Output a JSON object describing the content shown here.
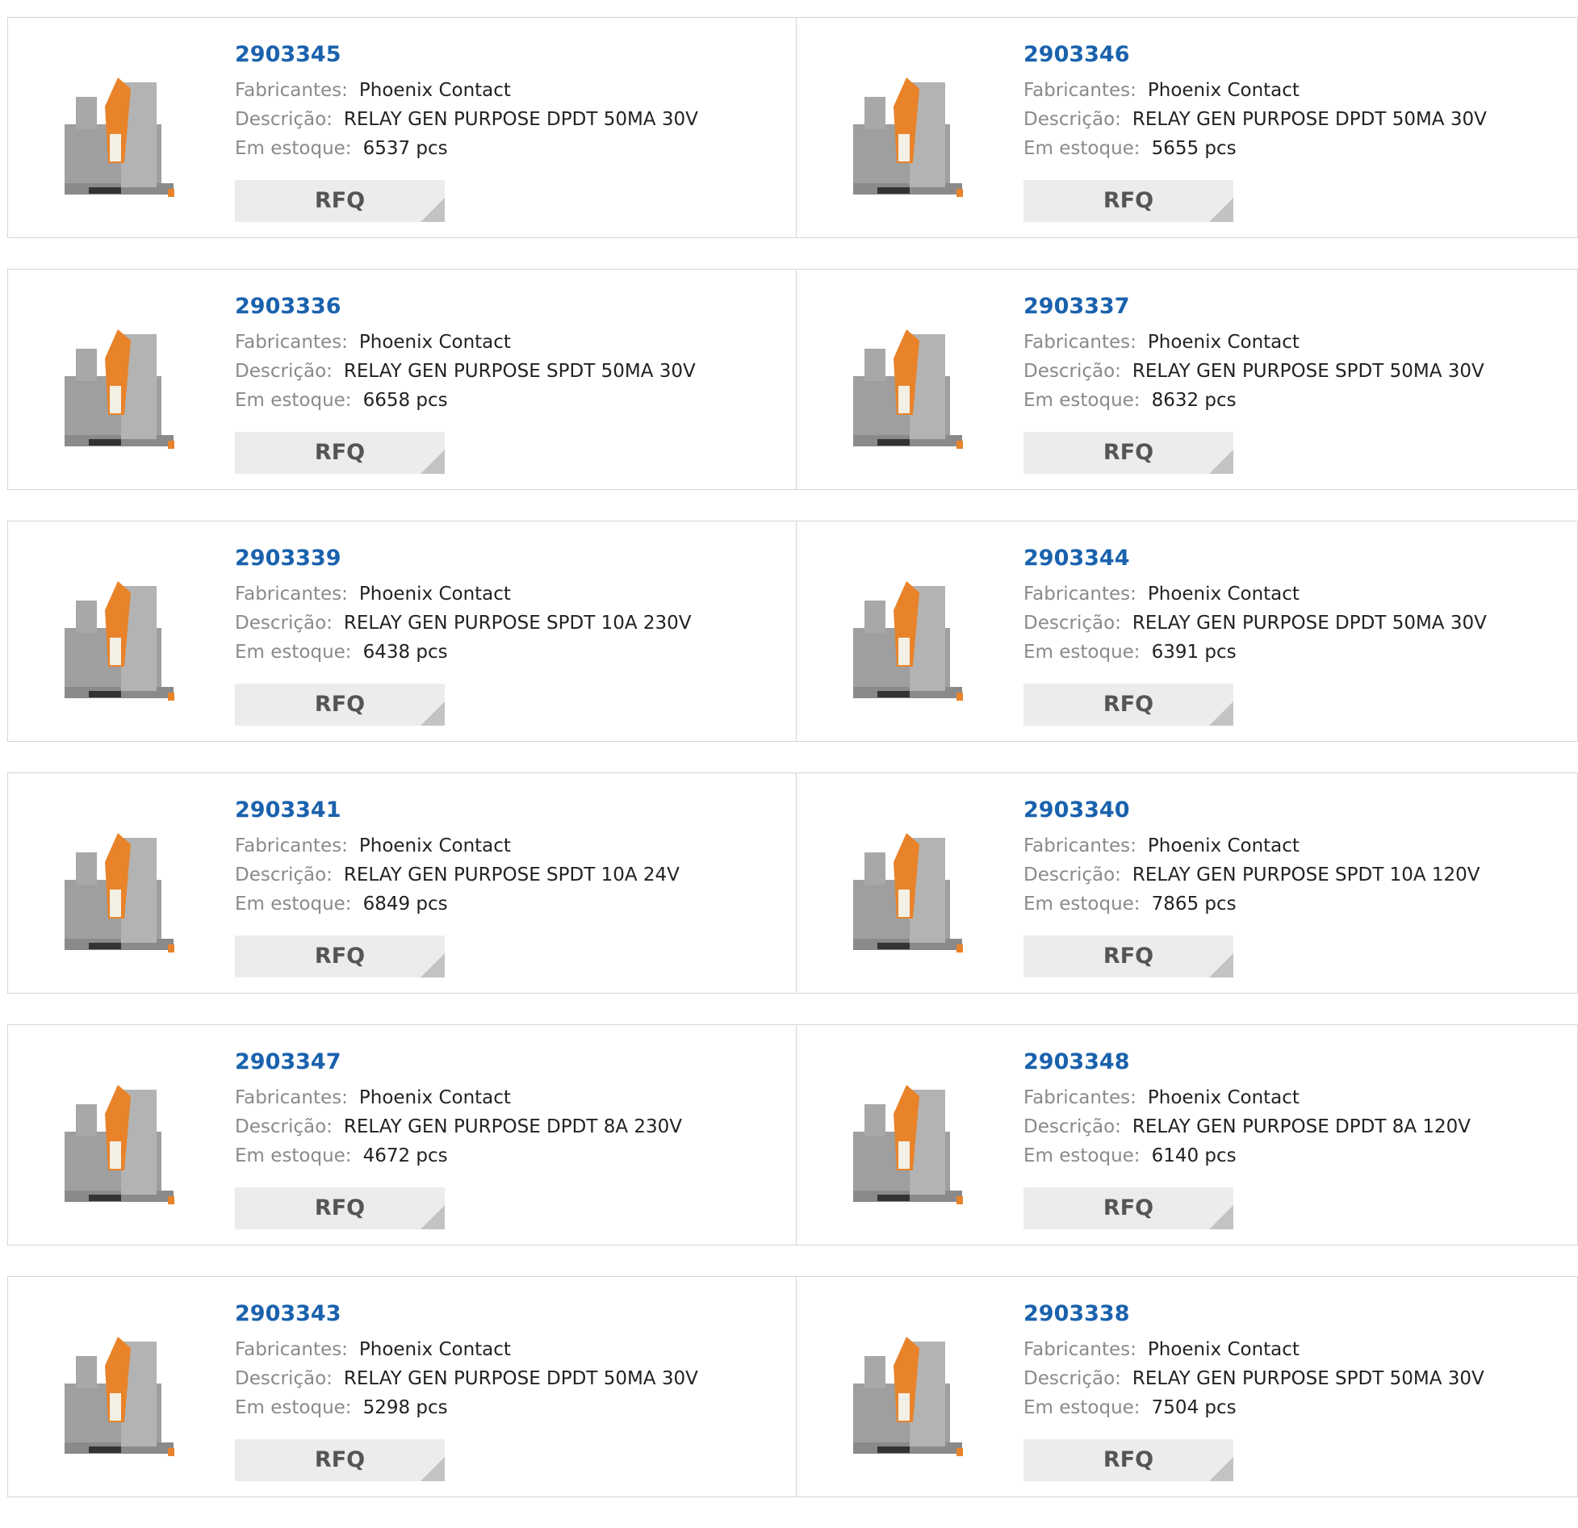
{
  "labels": {
    "manufacturer": "Fabricantes:",
    "description": "Descrição:",
    "stock": "Em estoque:",
    "stock_unit": "pcs",
    "rfq": "RFQ"
  },
  "colors": {
    "part_link": "#1a62ad",
    "relay_orange": "#e8832a",
    "relay_gray": "#9a9a9a"
  },
  "products": [
    {
      "part": "2903345",
      "manufacturer": "Phoenix Contact",
      "description": "RELAY GEN PURPOSE DPDT 50MA 30V",
      "stock": "6537",
      "image": "relay-compact-icon"
    },
    {
      "part": "2903346",
      "manufacturer": "Phoenix Contact",
      "description": "RELAY GEN PURPOSE DPDT 50MA 30V",
      "stock": "5655",
      "image": "relay-tall-dark-icon"
    },
    {
      "part": "2903336",
      "manufacturer": "Phoenix Contact",
      "description": "RELAY GEN PURPOSE SPDT 50MA 30V",
      "stock": "6658",
      "image": "relay-block-icon"
    },
    {
      "part": "2903337",
      "manufacturer": "Phoenix Contact",
      "description": "RELAY GEN PURPOSE SPDT 50MA 30V",
      "stock": "8632",
      "image": "relay-block-icon"
    },
    {
      "part": "2903339",
      "manufacturer": "Phoenix Contact",
      "description": "RELAY GEN PURPOSE SPDT 10A 230V",
      "stock": "6438",
      "image": "relay-tall-icon"
    },
    {
      "part": "2903344",
      "manufacturer": "Phoenix Contact",
      "description": "RELAY GEN PURPOSE DPDT 50MA 30V",
      "stock": "6391",
      "image": "relay-compact-icon"
    },
    {
      "part": "2903341",
      "manufacturer": "Phoenix Contact",
      "description": "RELAY GEN PURPOSE SPDT 10A 24V",
      "stock": "6849",
      "image": "relay-tall-icon"
    },
    {
      "part": "2903340",
      "manufacturer": "Phoenix Contact",
      "description": "RELAY GEN PURPOSE SPDT 10A 120V",
      "stock": "7865",
      "image": "relay-tall-icon"
    },
    {
      "part": "2903347",
      "manufacturer": "Phoenix Contact",
      "description": "RELAY GEN PURPOSE DPDT 8A 230V",
      "stock": "4672",
      "image": "relay-compact-icon"
    },
    {
      "part": "2903348",
      "manufacturer": "Phoenix Contact",
      "description": "RELAY GEN PURPOSE DPDT 8A 120V",
      "stock": "6140",
      "image": "relay-compact-icon"
    },
    {
      "part": "2903343",
      "manufacturer": "Phoenix Contact",
      "description": "RELAY GEN PURPOSE DPDT 50MA 30V",
      "stock": "5298",
      "image": "relay-compact-icon"
    },
    {
      "part": "2903338",
      "manufacturer": "Phoenix Contact",
      "description": "RELAY GEN PURPOSE SPDT 50MA 30V",
      "stock": "7504",
      "image": "relay-block-icon"
    }
  ]
}
